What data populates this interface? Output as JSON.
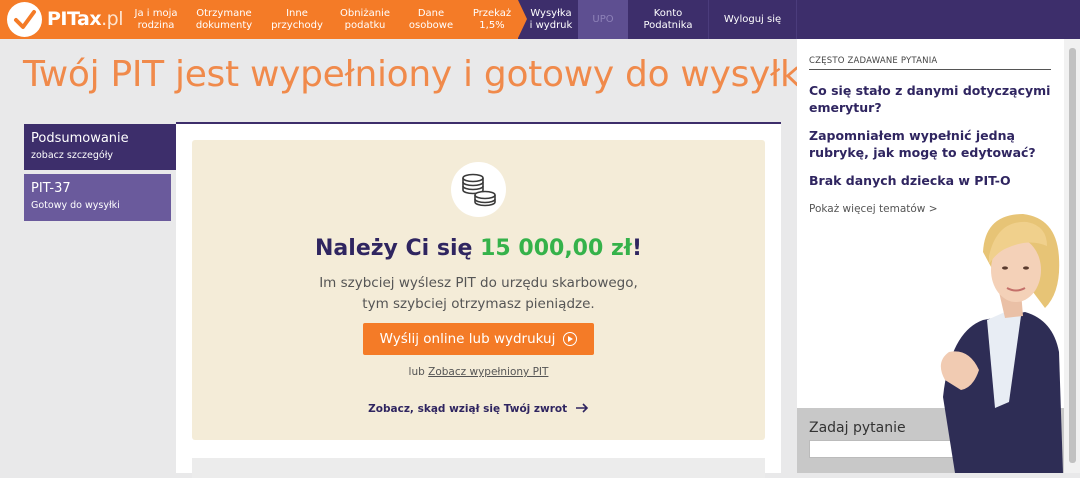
{
  "nav": {
    "logo_main": "PITax",
    "logo_suffix": ".pl",
    "items": [
      {
        "label": "Ja i moja\nrodzina"
      },
      {
        "label": "Otrzymane\ndokumenty"
      },
      {
        "label": "Inne\nprzychody"
      },
      {
        "label": "Obniżanie\npodatku"
      },
      {
        "label": "Dane\nosobowe"
      },
      {
        "label": "Przekaż\n1,5%"
      },
      {
        "label": "Wysyłka\ni wydruk"
      },
      {
        "label": "UPO"
      },
      {
        "label": "Konto\nPodatnika"
      },
      {
        "label": "Wyloguj się"
      }
    ],
    "colors": {
      "orange": "#f47b27",
      "purple": "#3d2e6b"
    }
  },
  "page": {
    "title": "Twój PIT jest wypełniony i gotowy do wysyłki"
  },
  "sidebar": {
    "tabs": [
      {
        "title": "Podsumowanie",
        "subtitle": "zobacz szczegóły"
      },
      {
        "title": "PIT-37",
        "subtitle": "Gotowy do wysyłki"
      }
    ]
  },
  "refund": {
    "icon": "coins-icon",
    "headline_prefix": "Należy Ci się",
    "amount": "15 000,00 zł",
    "headline_suffix": "!",
    "text_line1": "Im szybciej wyślesz PIT do urzędu skarbowego,",
    "text_line2": "tym szybciej otrzymasz pieniądze.",
    "send_button": "Wyślij online lub wydrukuj",
    "or_prefix": "lub",
    "view_link": "Zobacz wypełniony PIT",
    "source_link": "Zobacz, skąd wziął się Twój zwrot",
    "amount_color": "#35b24a"
  },
  "faq": {
    "caption": "CZĘSTO ZADAWANE PYTANIA",
    "questions": [
      "Co się stało z danymi dotyczącymi emerytur?",
      "Zapomniałem wypełnić jedną rubrykę, jak mogę to edytować?",
      "Brak danych dziecka w PIT-O"
    ],
    "more_link": "Pokaż więcej tematów >"
  },
  "ask": {
    "label": "Zadaj pytanie",
    "placeholder": ""
  }
}
